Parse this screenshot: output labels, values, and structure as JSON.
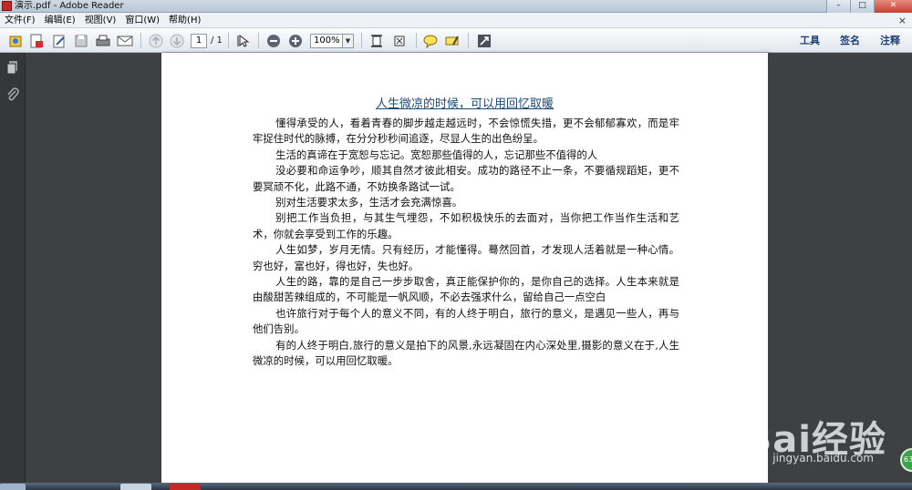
{
  "window": {
    "title": "演示.pdf - Adobe Reader",
    "buttons": {
      "minimize": "–",
      "maximize": "□",
      "close": "✕"
    }
  },
  "menubar": {
    "items": [
      "文件(F)",
      "编辑(E)",
      "视图(V)",
      "窗口(W)",
      "帮助(H)"
    ],
    "close_glyph": "×"
  },
  "toolbar": {
    "page_current": "1",
    "page_total": "/ 1",
    "zoom": "100%",
    "zoom_arrow": "▼",
    "right_tools": [
      "工具",
      "签名",
      "注释"
    ]
  },
  "document": {
    "title": "人生微凉的时候，可以用回忆取暖",
    "paragraphs": [
      "懂得承受的人，看着青春的脚步越走越远时，不会惊慌失措，更不会郁郁寡欢，而是牢牢捉住时代的脉搏，在分分秒秒间追逐，尽显人生的出色纷呈。",
      "生活的真谛在于宽恕与忘记。宽恕那些值得的人，忘记那些不值得的人",
      "没必要和命运争吵，顺其自然才彼此相安。成功的路径不止一条，不要循规蹈矩，更不要冥顽不化，此路不通，不妨换条路试一试。",
      "别对生活要求太多，生活才会充满惊喜。",
      "别把工作当负担，与其生气埋怨，不如积极快乐的去面对，当你把工作当作生活和艺术，你就会享受到工作的乐趣。",
      "人生如梦，岁月无情。只有经历，才能懂得。蓦然回首，才发现人活着就是一种心情。穷也好，富也好，得也好，失也好。",
      "人生的路，靠的是自己一步步取舍，真正能保护你的，是你自己的选择。人生本来就是由酸甜苦辣组成的，不可能是一帆风顺，不必去强求什么，留给自己一点空白",
      "也许旅行对于每个人的意义不同，有的人终于明白，旅行的意义，是遇见一些人，再与他们告别。",
      "有的人终于明白,旅行的意义是拍下的风景,永远凝固在内心深处里,摄影的意义在于,人生微凉的时候，可以用回忆取暖。"
    ]
  },
  "watermark": {
    "brand": "Bai经验",
    "url": "jingyan.baidu.com"
  },
  "badge": {
    "text": "63"
  },
  "colors": {
    "accent": "#1e3f74",
    "title": "#1c4b7a",
    "canvas": "#3d4144"
  }
}
